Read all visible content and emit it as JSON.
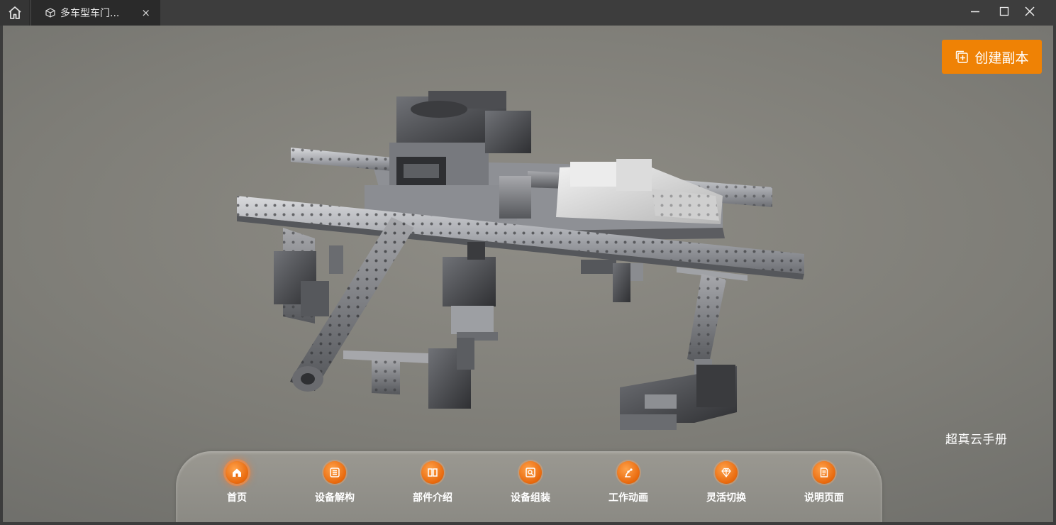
{
  "window": {
    "tab_title": "多车型车门...",
    "tab_close": "×",
    "icons": {
      "home": "home-icon",
      "tab": "cube-icon",
      "minimize": "minimize-icon",
      "maximize": "maximize-icon",
      "close": "close-icon"
    }
  },
  "toolbar": {
    "copy_label": "创建副本",
    "copy_icon": "copy-plus-icon",
    "accent_color": "#EF8205"
  },
  "brand": {
    "label": "超真云手册"
  },
  "nav": {
    "items": [
      {
        "label": "首页",
        "icon": "home-icon",
        "active": true
      },
      {
        "label": "设备解构",
        "icon": "list-icon",
        "active": false
      },
      {
        "label": "部件介绍",
        "icon": "book-icon",
        "active": false
      },
      {
        "label": "设备组装",
        "icon": "assemble-icon",
        "active": false
      },
      {
        "label": "工作动画",
        "icon": "robot-arm-icon",
        "active": false
      },
      {
        "label": "灵活切换",
        "icon": "diamond-icon",
        "active": false
      },
      {
        "label": "说明页面",
        "icon": "document-icon",
        "active": false
      }
    ]
  }
}
